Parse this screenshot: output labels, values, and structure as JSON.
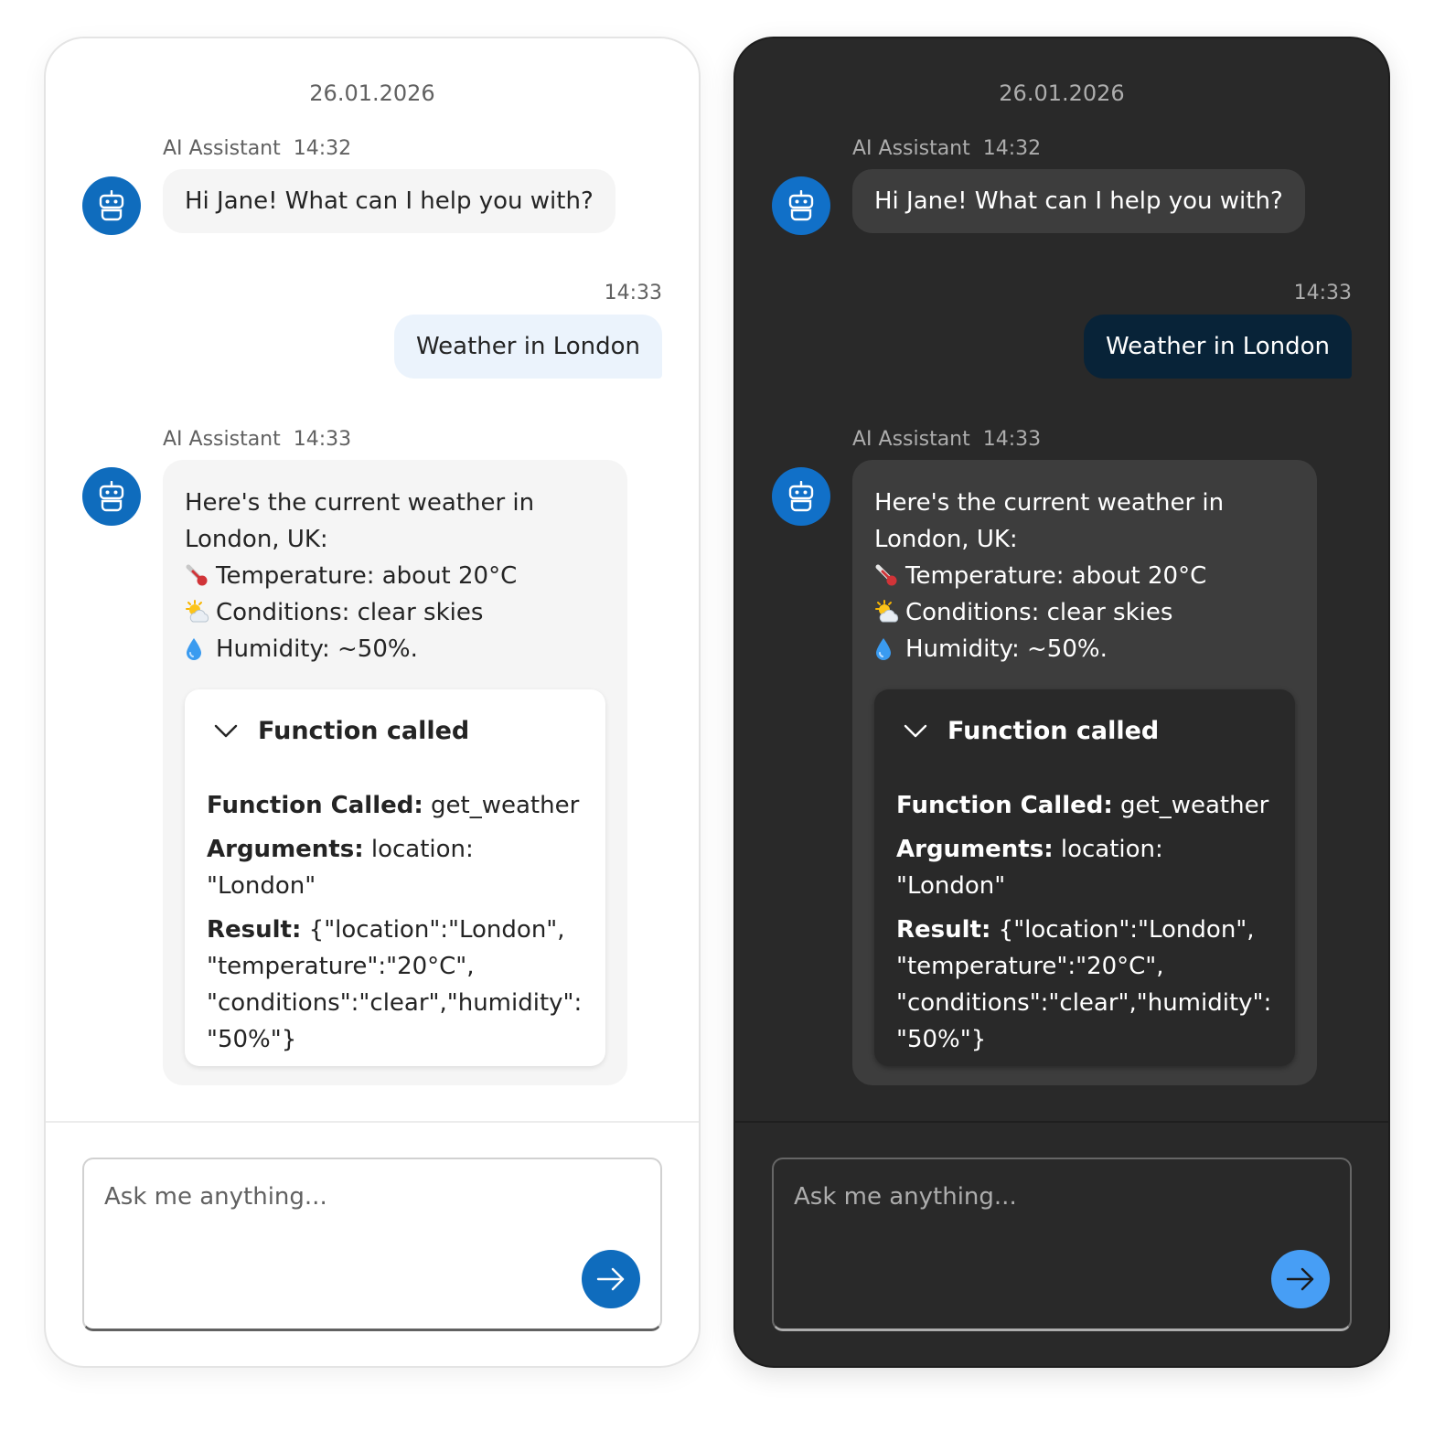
{
  "panels": [
    {
      "theme": "light",
      "date": "26.01.2026",
      "messages": [
        {
          "sender": "AI Assistant",
          "time": "14:32",
          "text": "Hi Jane! What can I help you with?"
        },
        {
          "sender": "user",
          "time": "14:33",
          "text": "Weather in London"
        },
        {
          "sender": "AI Assistant",
          "time": "14:33",
          "intro_line1": "Here's the current weather in",
          "intro_line2": "London, UK:",
          "temp": "Temperature: about 20°C",
          "conditions": "Conditions: clear skies",
          "humidity": "Humidity: ~50%.",
          "function_card": {
            "title": "Function called",
            "function_label": "Function Called:",
            "function_value": "get_weather",
            "arguments_label": "Arguments:",
            "arguments_value": "location: \"London\"",
            "result_label": "Result:",
            "result_line1": "{\"location\":\"London\",",
            "result_line2": "\"temperature\":\"20°C\",",
            "result_line3": "\"conditions\":\"clear\",\"humidity\":",
            "result_line4": "\"50%\"}"
          }
        }
      ],
      "composer": {
        "placeholder": "Ask me anything..."
      }
    },
    {
      "theme": "dark",
      "date": "26.01.2026",
      "messages": [
        {
          "sender": "AI Assistant",
          "time": "14:32",
          "text": "Hi Jane! What can I help you with?"
        },
        {
          "sender": "user",
          "time": "14:33",
          "text": "Weather in London"
        },
        {
          "sender": "AI Assistant",
          "time": "14:33",
          "intro_line1": "Here's the current weather in",
          "intro_line2": "London, UK:",
          "temp": "Temperature: about 20°C",
          "conditions": "Conditions: clear skies",
          "humidity": "Humidity: ~50%.",
          "function_card": {
            "title": "Function called",
            "function_label": "Function Called:",
            "function_value": "get_weather",
            "arguments_label": "Arguments:",
            "arguments_value": "location: \"London\"",
            "result_label": "Result:",
            "result_line1": "{\"location\":\"London\",",
            "result_line2": "\"temperature\":\"20°C\",",
            "result_line3": "\"conditions\":\"clear\",\"humidity\":",
            "result_line4": "\"50%\"}"
          }
        }
      ],
      "composer": {
        "placeholder": "Ask me anything..."
      }
    }
  ],
  "icons": {
    "avatar": "bot-icon",
    "temperature": "thermometer-icon",
    "conditions": "sun-behind-cloud-icon",
    "humidity": "droplet-icon",
    "expand": "chevron-down-icon",
    "send": "arrow-right-icon"
  },
  "colors": {
    "brand": "#0f6cbd",
    "brand_dark": "#479ef5",
    "user_bubble_light": "#ebf3fc",
    "user_bubble_dark": "#082338"
  }
}
